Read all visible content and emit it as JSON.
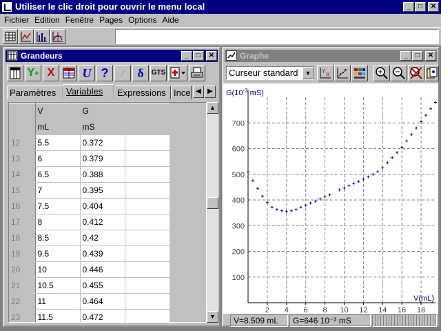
{
  "app": {
    "title": "Utiliser le clic droit pour ouvrir le menu local"
  },
  "menu": [
    "Fichier",
    "Edition",
    "Fenêtre",
    "Pages",
    "Options",
    "Aide"
  ],
  "main_toolbar": {
    "icons": [
      "table-icon",
      "line-chart-icon",
      "histogram-icon",
      "crosshair-chart-icon"
    ],
    "entry_value": ""
  },
  "grandeurs": {
    "title": "Grandeurs",
    "toolbar": [
      "edit-table-icon",
      "add-variable-icon",
      "delete-variable-icon",
      "grid-icon",
      "units-icon",
      "help-icon",
      "check-icon",
      "delta-icon",
      "GTS",
      "new-page-icon",
      "print-icon"
    ],
    "gts_label": "GTS",
    "tabs": [
      "Paramètres",
      "Variables",
      "Expressions",
      "Ince"
    ],
    "active_tab": "Variables",
    "columns": [
      {
        "name": "V",
        "unit": "mL"
      },
      {
        "name": "G",
        "unit": "mS"
      },
      {
        "name": "",
        "unit": ""
      }
    ],
    "rows": [
      {
        "n": "12",
        "V": "5.5",
        "G": "0.372"
      },
      {
        "n": "13",
        "V": "6",
        "G": "0.379"
      },
      {
        "n": "14",
        "V": "6.5",
        "G": "0.388"
      },
      {
        "n": "15",
        "V": "7",
        "G": "0.395"
      },
      {
        "n": "16",
        "V": "7.5",
        "G": "0.404"
      },
      {
        "n": "17",
        "V": "8",
        "G": "0.412"
      },
      {
        "n": "18",
        "V": "8.5",
        "G": "0.42"
      },
      {
        "n": "19",
        "V": "9.5",
        "G": "0.439"
      },
      {
        "n": "20",
        "V": "10",
        "G": "0.446"
      },
      {
        "n": "21",
        "V": "10.5",
        "G": "0.455"
      },
      {
        "n": "22",
        "V": "11",
        "G": "0.464"
      },
      {
        "n": "23",
        "V": "11.5",
        "G": "0.472"
      }
    ],
    "scroll_position": 0.45
  },
  "graphe": {
    "title": "Graphe",
    "cursor_mode": "Curseur standard",
    "toolbar": [
      "axes-icon",
      "regression-icon",
      "colors-icon",
      "zoom-in-icon",
      "zoom-out-icon",
      "zoom-reset-icon",
      "copy-icon"
    ],
    "status": {
      "v": "V=8.509 mL",
      "g": "G=646 10⁻³ mS"
    }
  },
  "chart_data": {
    "type": "scatter",
    "ylabel_base": "G(10",
    "ylabel_exp": "-3",
    "ylabel_unit": " mS)",
    "xlabel": "V(mL)",
    "xlim": [
      0,
      19.5
    ],
    "ylim": [
      0,
      800
    ],
    "xticks": [
      2,
      4,
      6,
      8,
      10,
      12,
      14,
      16,
      18
    ],
    "yticks": [
      100,
      200,
      300,
      400,
      500,
      600,
      700
    ],
    "grid": true,
    "marker_color": "#0000c0",
    "points": [
      [
        0,
        510
      ],
      [
        0.5,
        475
      ],
      [
        1,
        445
      ],
      [
        1.5,
        415
      ],
      [
        2,
        390
      ],
      [
        2.5,
        372
      ],
      [
        3,
        363
      ],
      [
        3.5,
        358
      ],
      [
        4,
        355
      ],
      [
        4.5,
        358
      ],
      [
        5,
        363
      ],
      [
        5.5,
        372
      ],
      [
        6,
        379
      ],
      [
        6.5,
        388
      ],
      [
        7,
        395
      ],
      [
        7.5,
        404
      ],
      [
        8,
        412
      ],
      [
        8.5,
        420
      ],
      [
        9.5,
        439
      ],
      [
        10,
        446
      ],
      [
        10.5,
        455
      ],
      [
        11,
        464
      ],
      [
        11.5,
        472
      ],
      [
        12,
        481
      ],
      [
        12.5,
        490
      ],
      [
        13,
        500
      ],
      [
        13.5,
        510
      ],
      [
        14,
        525
      ],
      [
        14.5,
        545
      ],
      [
        15,
        565
      ],
      [
        15.5,
        585
      ],
      [
        16,
        605
      ],
      [
        16.5,
        630
      ],
      [
        17,
        655
      ],
      [
        17.5,
        680
      ],
      [
        18,
        705
      ],
      [
        18.5,
        730
      ],
      [
        19,
        755
      ],
      [
        19.5,
        780
      ]
    ]
  }
}
